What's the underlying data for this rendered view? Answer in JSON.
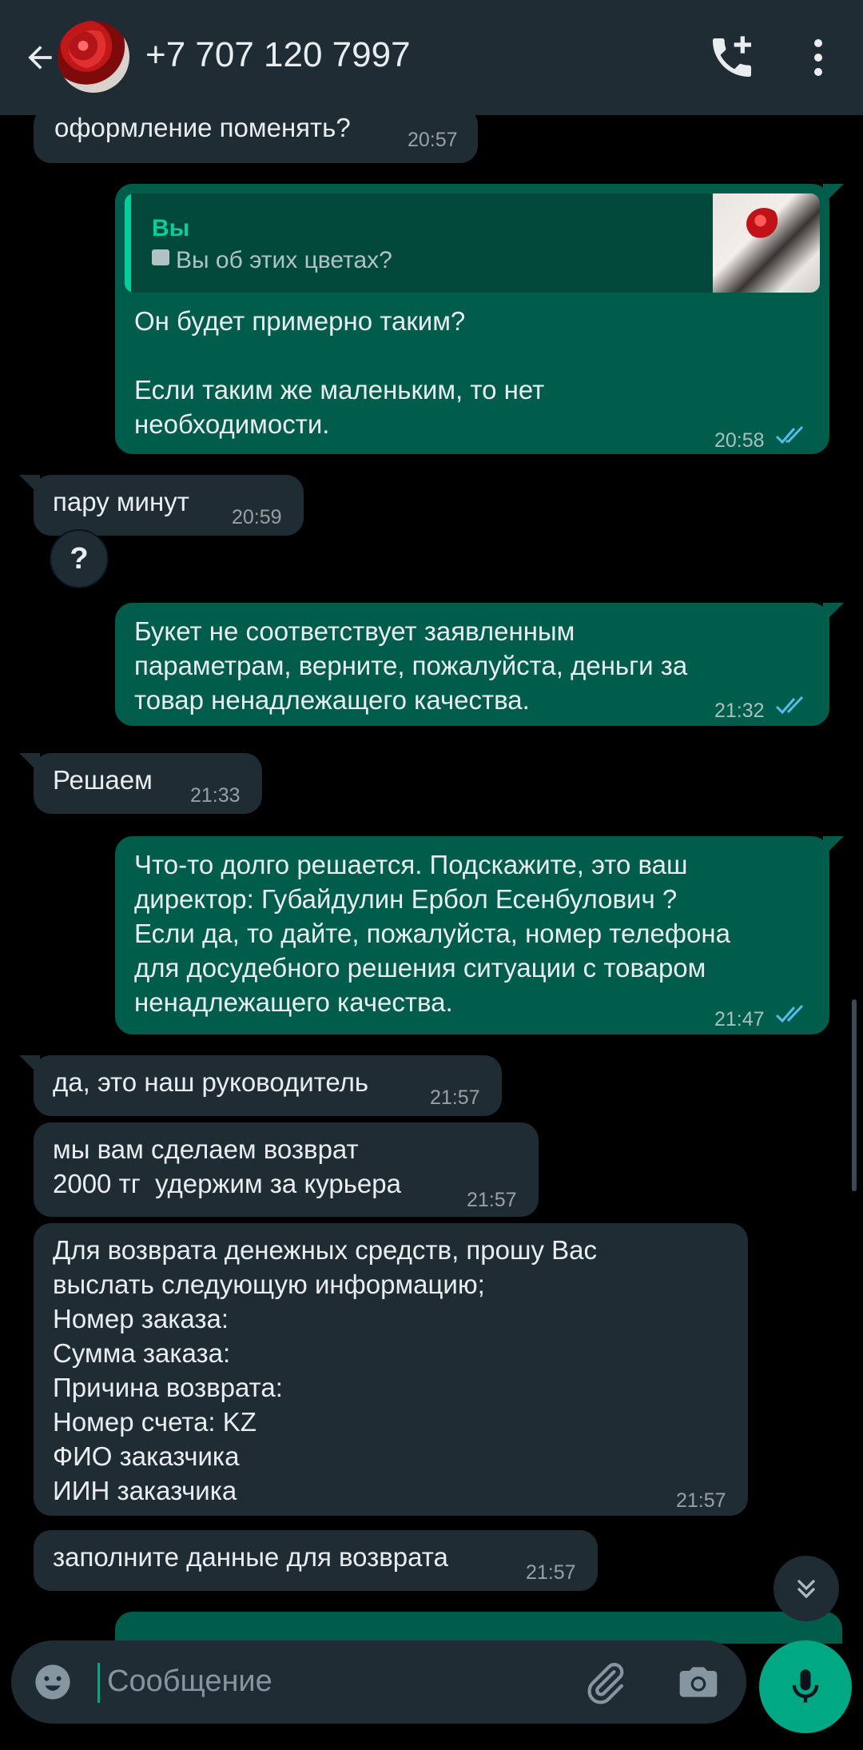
{
  "header": {
    "title": "+7 707 120 7997",
    "back_icon": "arrow-left-icon",
    "call_icon": "add-call-icon",
    "more_icon": "more-vertical-icon"
  },
  "messages": [
    {
      "direction": "in",
      "text": "оформление поменять?",
      "time": "20:57"
    },
    {
      "direction": "out",
      "quote": {
        "author": "Вы",
        "text": "Вы об этих цветах?"
      },
      "text": "Он будет примерно таким?\n\nЕсли таким же маленьким, то нет\nнеобходимости.",
      "time": "20:58",
      "status": "read"
    },
    {
      "direction": "in",
      "text": "пару минут",
      "time": "20:59",
      "reaction": "?"
    },
    {
      "direction": "out",
      "text": "Букет не соответствует заявленным\nпараметрам, верните, пожалуйста, деньги за\nтовар ненадлежащего качества.",
      "time": "21:32",
      "status": "read"
    },
    {
      "direction": "in",
      "text": "Решаем",
      "time": "21:33"
    },
    {
      "direction": "out",
      "text": "Что-то долго решается. Подскажите, это ваш\nдиректор: Губайдулин Ербол Есенбулович ?\nЕсли да, то дайте, пожалуйста, номер телефона\nдля досудебного решения ситуации с товаром\nненадлежащего качества.",
      "time": "21:47",
      "status": "read"
    },
    {
      "direction": "in",
      "text": "да, это наш руководитель",
      "time": "21:57"
    },
    {
      "direction": "in",
      "text": "мы вам сделаем возврат\n2000 тг  удержим за курьера",
      "time": "21:57"
    },
    {
      "direction": "in",
      "text": "Для возврата денежных средств, прошу Вас\nвыслать следующую информацию;\nНомер заказа:\nСумма заказа:\nПричина возврата:\nНомер счета: KZ\nФИО заказчика\nИИН заказчика",
      "time": "21:57"
    },
    {
      "direction": "in",
      "text": "заполните данные для возврата",
      "time": "21:57"
    }
  ],
  "composer": {
    "placeholder": "Сообщение",
    "emoji_icon": "emoji-icon",
    "attach_icon": "paperclip-icon",
    "camera_icon": "camera-icon",
    "mic_icon": "microphone-icon"
  },
  "colors": {
    "header_bg": "#1f2c34",
    "incoming_bubble": "#202c33",
    "outgoing_bubble": "#005c4b",
    "accent": "#00a884",
    "read_ticks": "#53bdeb"
  }
}
